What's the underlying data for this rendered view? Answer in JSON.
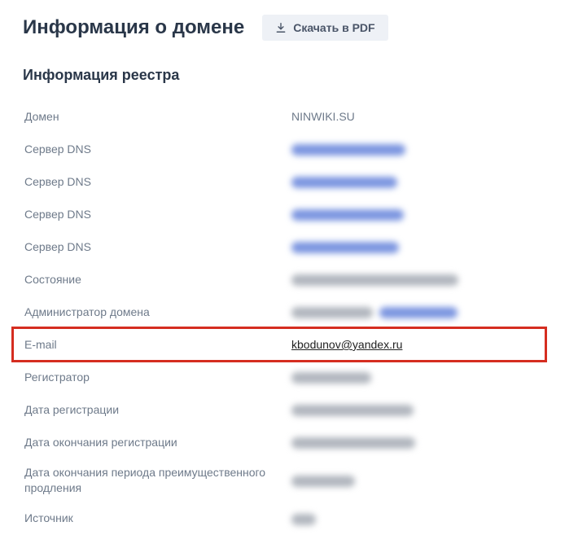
{
  "header": {
    "title": "Информация о домене",
    "pdf_button": "Скачать в PDF"
  },
  "section_title": "Информация реестра",
  "rows": {
    "domain": {
      "label": "Домен",
      "value": "NINWIKI.SU"
    },
    "dns1": {
      "label": "Сервер DNS"
    },
    "dns2": {
      "label": "Сервер DNS"
    },
    "dns3": {
      "label": "Сервер DNS"
    },
    "dns4": {
      "label": "Сервер DNS"
    },
    "state": {
      "label": "Состояние"
    },
    "admin": {
      "label": "Администратор домена"
    },
    "email": {
      "label": "E-mail",
      "value": "kbodunov@yandex.ru"
    },
    "registrar": {
      "label": "Регистратор"
    },
    "reg_date": {
      "label": "Дата регистрации"
    },
    "reg_end": {
      "label": "Дата окончания регистрации"
    },
    "pref_end": {
      "label": "Дата окончания периода преимущественного продления"
    },
    "source": {
      "label": "Источник"
    }
  }
}
